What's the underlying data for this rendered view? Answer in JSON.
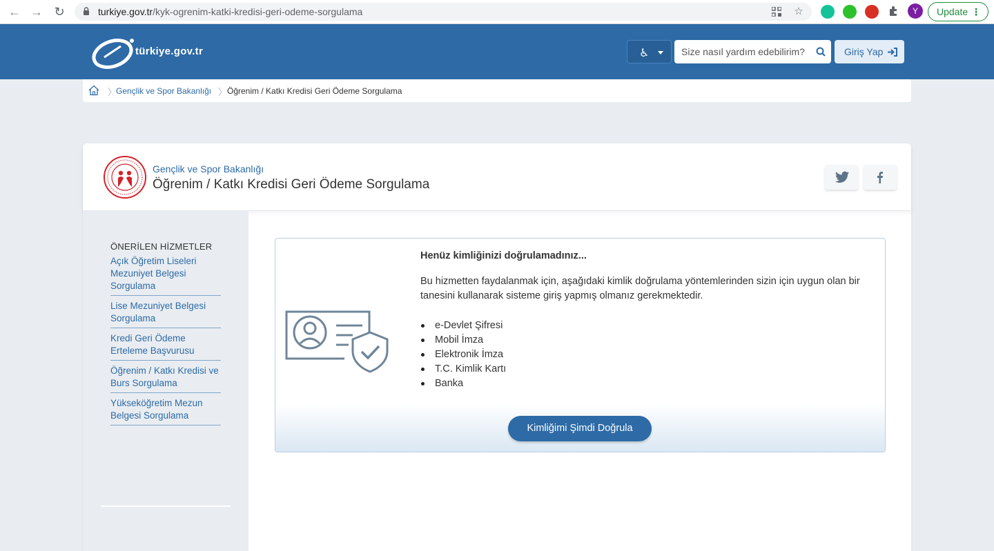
{
  "browser": {
    "url_host": "turkiye.gov.tr",
    "url_path": "/kyk-ogrenim-katki-kredisi-geri-odeme-sorgulama",
    "profile_initial": "Y",
    "update_label": "Update",
    "menu_glyph": "⋮"
  },
  "header": {
    "logo_text": "türkiye.gov.tr",
    "search_placeholder": "Size nasıl yardım edebilirim?",
    "login_label": "Giriş Yap",
    "accessibility_glyph": "♿"
  },
  "breadcrumb": {
    "items": [
      "Gençlik ve Spor Bakanlığı",
      "Öğrenim / Katkı Kredisi Geri Ödeme Sorgulama"
    ]
  },
  "page": {
    "institution": "Gençlik ve Spor Bakanlığı",
    "title": "Öğrenim / Katkı Kredisi Geri Ödeme Sorgulama"
  },
  "sidebar": {
    "title": "ÖNERİLEN HİZMETLER",
    "items": [
      {
        "label": "Açık Öğretim Liseleri Mezuniyet Belgesi Sorgulama"
      },
      {
        "label": "Lise Mezuniyet Belgesi Sorgulama"
      },
      {
        "label": "Kredi Geri Ödeme Erteleme Başvurusu"
      },
      {
        "label": "Öğrenim / Katkı Kredisi ve Burs Sorgulama"
      },
      {
        "label": "Yükseköğretim Mezun Belgesi Sorgulama"
      }
    ]
  },
  "auth": {
    "title": "Henüz kimliğinizi doğrulamadınız...",
    "description": "Bu hizmetten faydalanmak için, aşağıdaki kimlik doğrulama yöntemlerinden sizin için uygun olan bir tanesini kullanarak sisteme giriş yapmış olmanız gerekmektedir.",
    "methods": [
      "e-Devlet Şifresi",
      "Mobil İmza",
      "Elektronik İmza",
      "T.C. Kimlik Kartı",
      "Banka"
    ],
    "verify_label": "Kimliğimi Şimdi Doğrula"
  },
  "colors": {
    "brand": "#2d6aa6",
    "page_bg": "#e9edf1",
    "emblem_red": "#d2232a"
  }
}
